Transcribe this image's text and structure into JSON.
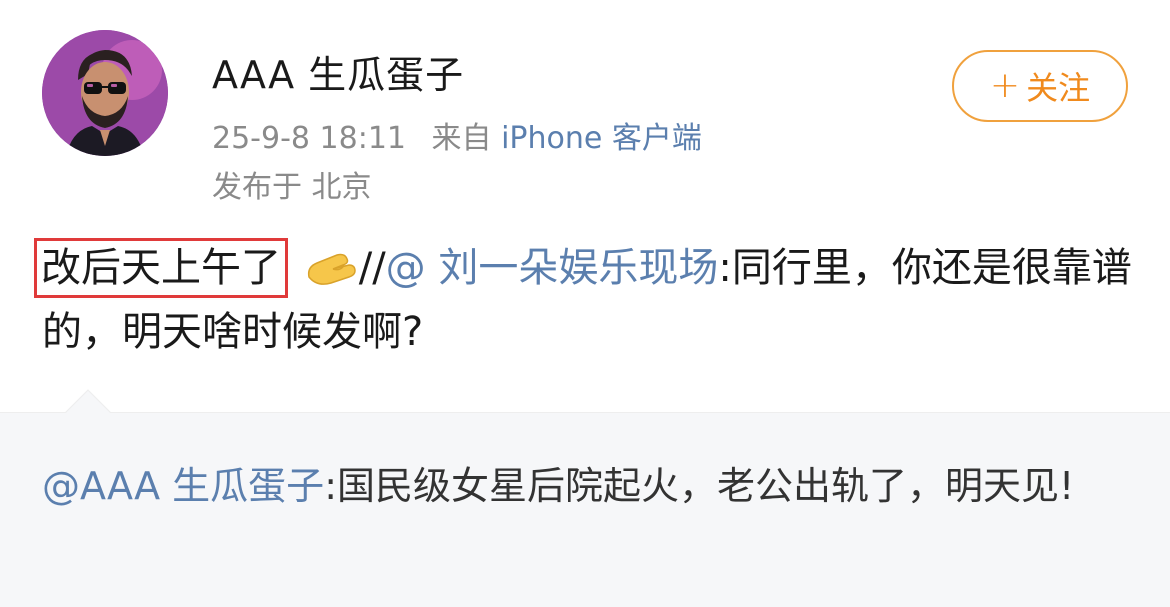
{
  "post": {
    "username": "AAA 生瓜蛋子",
    "timestamp": "25-9-8 18:11",
    "source_prefix": "来自",
    "source": "iPhone 客户端",
    "location": "发布于 北京",
    "follow_button": {
      "icon": "plus-icon",
      "plus": "+",
      "label": "关注"
    },
    "avatar_icon": "avatar-icon",
    "content": {
      "highlight_text": "改后天上午了",
      "emoji": "pinching-hand-emoji",
      "slashes": "//",
      "mention": "@ 刘一朵娱乐现场",
      "body": ":同行里，你还是很靠谱的，明天啥时候发啊?"
    },
    "highlight_color": "#e03a3a"
  },
  "retweet": {
    "mention": "@AAA 生瓜蛋子",
    "body": ":国民级女星后院起火，老公出轨了，明天见!"
  },
  "colors": {
    "link": "#5b7fae",
    "follow": "#f08a1d",
    "meta": "#8a8a8a",
    "retweet_bg": "#f6f7f9"
  }
}
